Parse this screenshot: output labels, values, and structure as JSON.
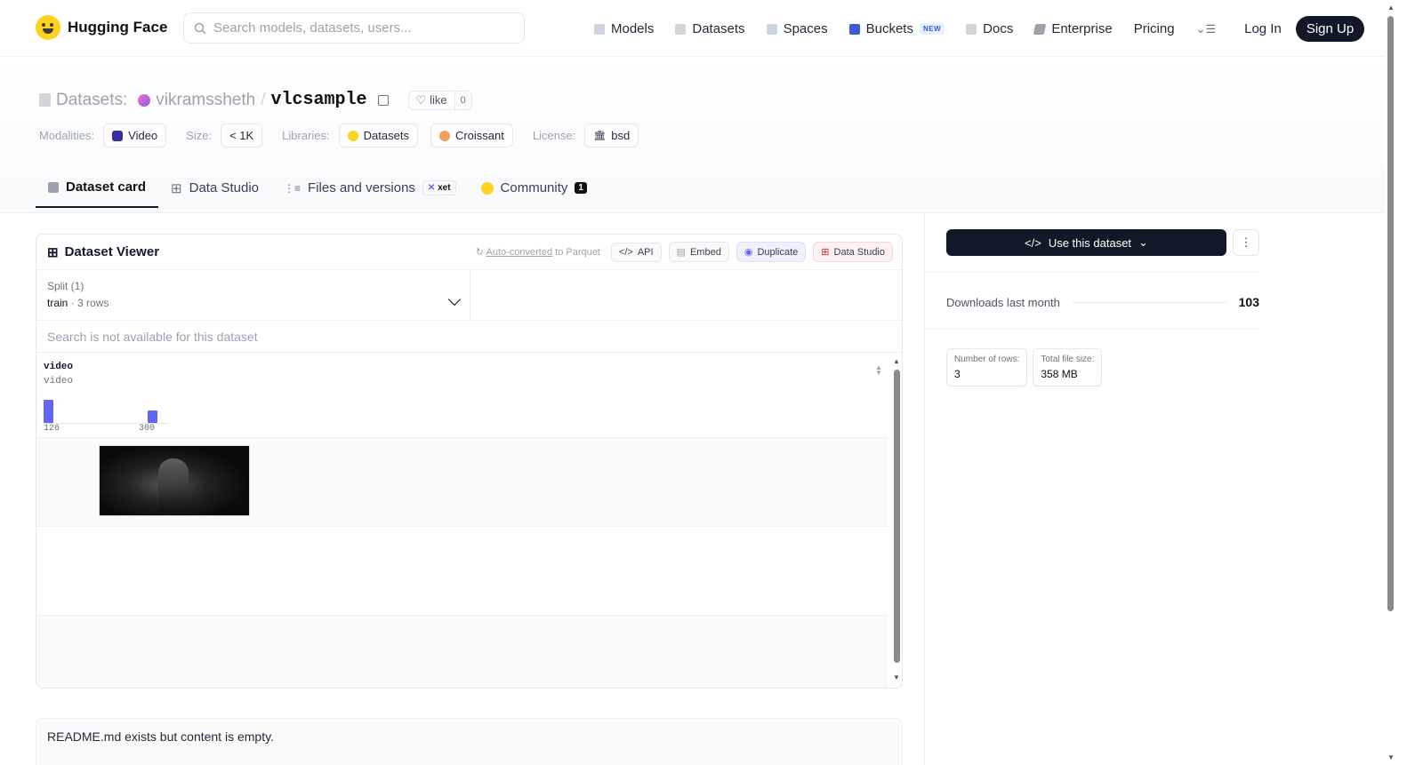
{
  "nav": {
    "brand": "Hugging Face",
    "search_placeholder": "Search models, datasets, users...",
    "links": [
      {
        "label": "Models",
        "icon": "cube-icon",
        "color": "#9ca3af"
      },
      {
        "label": "Datasets",
        "icon": "database-icon",
        "color": "#9ca3af"
      },
      {
        "label": "Spaces",
        "icon": "grid-icon",
        "color": "#9ca3af"
      },
      {
        "label": "Buckets",
        "icon": "bucket-icon",
        "color": "#3b5bdb"
      },
      {
        "label": "Docs",
        "icon": "book-icon",
        "color": "#9ca3af"
      },
      {
        "label": "Enterprise",
        "icon": "enterprise-icon",
        "color": "#6b7280"
      },
      {
        "label": "Pricing"
      }
    ],
    "new_badge": "NEW",
    "login": "Log In",
    "signup": "Sign Up"
  },
  "header": {
    "prefix": "Datasets:",
    "owner": "vikramssheth",
    "separator": "/",
    "name": "vlcsample",
    "like_label": "like",
    "like_count": "0",
    "modalities_label": "Modalities:",
    "modality": "Video",
    "size_label": "Size:",
    "size": "< 1K",
    "libraries_label": "Libraries:",
    "libraries": [
      "Datasets",
      "Croissant"
    ],
    "license_label": "License:",
    "license": "bsd"
  },
  "tabs": {
    "dataset_card": "Dataset card",
    "data_studio": "Data Studio",
    "files": "Files and versions",
    "xet": "xet",
    "community": "Community",
    "community_count": "1"
  },
  "viewer": {
    "title": "Dataset Viewer",
    "auto_converted": "Auto-converted",
    "to_parquet": "to Parquet",
    "api": "API",
    "embed": "Embed",
    "duplicate": "Duplicate",
    "data_studio": "Data Studio",
    "split_label": "Split (1)",
    "split_name": "train",
    "split_rows": "3 rows",
    "search_na": "Search is not available for this dataset",
    "column": {
      "name": "video",
      "type": "video",
      "hist_min": "126",
      "hist_max": "300"
    },
    "accent": "#6366f1"
  },
  "chart_data": {
    "type": "bar",
    "categories": [
      "126",
      "300"
    ],
    "values": [
      3,
      1.6
    ]
  },
  "readme": "README.md exists but content is empty.",
  "sidebar": {
    "use_button": "Use this dataset",
    "downloads_label": "Downloads last month",
    "downloads": "103",
    "rows_label": "Number of rows:",
    "rows": "3",
    "filesize_label": "Total file size:",
    "filesize": "358 MB"
  }
}
